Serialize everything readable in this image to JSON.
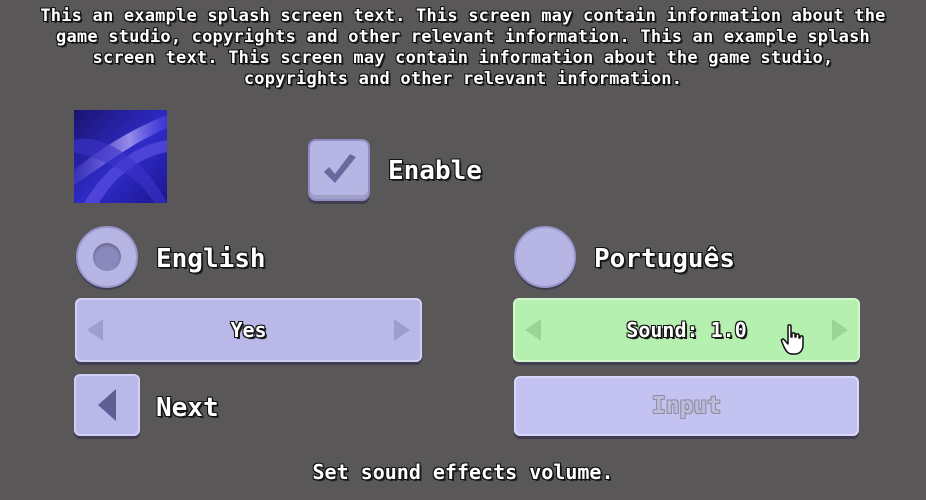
{
  "splash": {
    "text": "This an example splash screen text. This screen may contain information about the game studio, copyrights and other relevant information. This an example splash screen text. This screen may contain information about the game studio, copyrights and other relevant information."
  },
  "checkbox": {
    "label": "Enable",
    "checked": true
  },
  "language": {
    "options": [
      {
        "label": "English",
        "selected": true
      },
      {
        "label": "Português",
        "selected": false
      }
    ]
  },
  "spinners": {
    "yes_value": "Yes",
    "sound_value": "Sound: 1.0"
  },
  "buttons": {
    "next_label": "Next",
    "input_label": "Input"
  },
  "help_text": "Set sound effects volume.",
  "colors": {
    "background": "#595758",
    "widget": "#b9b8e8",
    "focused": "#b6f0b0"
  },
  "icons": [
    "image-thumbnail",
    "check-icon",
    "radio-icon",
    "arrow-left-icon",
    "arrow-right-icon",
    "back-arrow-icon",
    "hand-cursor-icon"
  ]
}
